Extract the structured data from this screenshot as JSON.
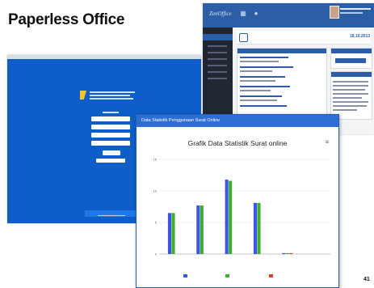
{
  "slide": {
    "title": "Paperless Office",
    "page_number": "41"
  },
  "dashboard": {
    "brand": "ZenOffice",
    "topbar_icons": [
      "grid-icon",
      "bell-icon"
    ],
    "date_text": "18.10.2013"
  },
  "chart_window": {
    "window_title": "Data Statistik Penggunaan Surat Online",
    "menu_icon": "menu-icon"
  },
  "chart_data": {
    "type": "bar",
    "title": "Grafik Data Statistik Surat online",
    "subtitle": "",
    "categories": [
      "",
      "",
      "",
      "",
      "",
      ""
    ],
    "series": [
      {
        "name": "",
        "color": "#3b55e6",
        "values": [
          6.5,
          7.7,
          11.8,
          8.1,
          0.15,
          0
        ]
      },
      {
        "name": "",
        "color": "#3fae2e",
        "values": [
          6.5,
          7.7,
          11.6,
          8.1,
          0.15,
          0
        ]
      },
      {
        "name": "",
        "color": "#e03b2c",
        "values": [
          0,
          0,
          0,
          0,
          0.15,
          0
        ]
      }
    ],
    "ylim": [
      0,
      15
    ],
    "yticks": [
      0,
      5,
      10,
      15
    ],
    "ylabel": "",
    "xlabel": "",
    "grid": true,
    "legend": "bottom"
  }
}
